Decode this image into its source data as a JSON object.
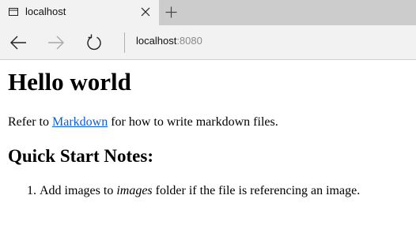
{
  "tab": {
    "title": "localhost",
    "favicon": "window-icon"
  },
  "toolbar": {
    "back_icon": "back-arrow-icon",
    "forward_icon": "forward-arrow-icon",
    "refresh_icon": "refresh-icon",
    "new_tab_icon": "plus-icon",
    "close_tab_icon": "close-icon"
  },
  "address": {
    "host": "localhost",
    "port": ":8080"
  },
  "content": {
    "heading": "Hello world",
    "intro_before": "Refer to ",
    "intro_link": "Markdown",
    "intro_after": " for how to write markdown files.",
    "subheading": "Quick Start Notes:",
    "notes": [
      {
        "before": "Add images to ",
        "emphasis": "images",
        "after": " folder if the file is referencing an image."
      }
    ]
  },
  "colors": {
    "tabstrip_bg": "#cccccc",
    "active_tab_bg": "#f2f2f2",
    "link": "#0b5cd6",
    "address_port": "#8a8a8a"
  }
}
